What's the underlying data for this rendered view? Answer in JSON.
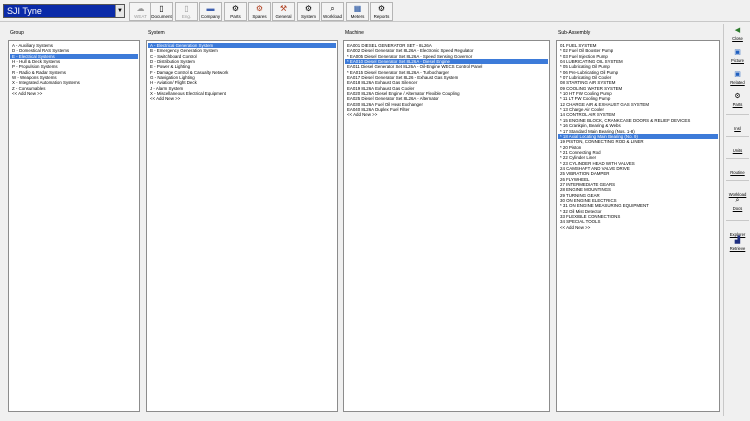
{
  "vessel": {
    "name": "SJI Tyne"
  },
  "toolbar": [
    {
      "label": "WEAT",
      "icon": "weather-icon",
      "disabled": true
    },
    {
      "label": "Document",
      "icon": "document-icon",
      "disabled": false
    },
    {
      "label": "Eng.",
      "icon": "engine-icon",
      "disabled": true
    },
    {
      "label": "Company",
      "icon": "company-icon",
      "disabled": false
    },
    {
      "label": "Parts",
      "icon": "parts-icon",
      "disabled": false
    },
    {
      "label": "Spares",
      "icon": "spares-icon",
      "disabled": false
    },
    {
      "label": "General",
      "icon": "general-icon",
      "disabled": false
    },
    {
      "label": "System",
      "icon": "system-icon",
      "disabled": false
    },
    {
      "label": "Workload",
      "icon": "workload-icon",
      "disabled": false
    },
    {
      "label": "Meters",
      "icon": "meters-icon",
      "disabled": false
    },
    {
      "label": "Reports",
      "icon": "reports-icon",
      "disabled": false
    }
  ],
  "panels": {
    "group": {
      "label": "Group",
      "items": [
        "A - Auxiliary Systems",
        "D - Domestical RAS Systems",
        "E - Electrical Systems",
        "H - Hull & Deck Systems",
        "P - Propulsion Systems",
        "R - Radio & Radar Systems",
        "W - Weapons Systems",
        "X - Integrated Automation Systems",
        "Z - Consumables",
        "<< Add New >>"
      ],
      "selected": 2
    },
    "system": {
      "label": "System",
      "items": [
        "A - Electrical Generation System",
        "B - Emergency Generation System",
        "C - Switchboard Control",
        "D - Distribution System",
        "E - Power & Lighting",
        "F - Damage Control & Casualty Network",
        "G - Navigation Lighting",
        "H - Aviation/ Flight Deck",
        "J - Alarm System",
        "X - Miscellaneous Electrical Equipment",
        "<< Add New >>"
      ],
      "selected": 0
    },
    "machine": {
      "label": "Machine",
      "items": [
        "EA001 DIESEL GENERATOR SET - 8L26A",
        "EA002 Diesel Generator Set 8L26A - Electronic Speed Regulator",
        "* EA005 Diesel Generator Set 8L26A - Speed Sensing Governor",
        "* EA010 Diesel Generator Set 8L26A - Diesel Engine",
        "EA011 Diesel Generator Set 8L26A - Oil-Engine WECS Control Panel",
        "* EA015 Diesel Generator Set 8L26A - Turbocharger",
        "EA017 Diesel Generator Set 8L26 - Exhaust Gas System",
        "EA018 8L26A Exhaust Gas Silencer",
        "EA019 8L26A Exhaust Gas Cooler",
        "EA020 8L26A Diesel Engine / Alternator Flexible Coupling",
        "EA025 Diesel Generator Set 8L26A - Alternator",
        "EA030 8L26A Fuel Oil Heat Exchanger",
        "EA040 8L26A Duplex Fuel Filter",
        "<< Add New >>"
      ],
      "selected": 3
    },
    "subassembly": {
      "label": "Sub-Assembly",
      "items": [
        "01 FUEL SYSTEM",
        "* 02 Fuel Oil Booster Pump",
        "* 03 Fuel Injection Pump",
        "04 LUBRICATING OIL SYSTEM",
        "* 05 Lubricating Oil Pump",
        "* 06 Pre-Lubricating Oil Pump",
        "* 07 Lubricating Oil Cooler",
        "08 STARTING AIR SYSTEM",
        "09 COOLING WATER SYSTEM",
        "* 10 HT FW Cooling Pump",
        "* 11 LT FW Cooling Pump",
        "12 CHARGE AIR & EXHAUST GAS SYSTEM",
        "* 13 Charge Air Cooler",
        "14 CONTROL AIR SYSTEM",
        "* 15 ENGINE BLOCK, CRANKCASE DOORS & RELIEF DEVICES",
        "* 16 Crankpin, Bearing & Webs",
        "* 17 Standard Main Bearing (Nos. 1-8)",
        "* 18 Axial Locating Main Bearing (No. 9)",
        "19 PISTON, CONNECTING ROD & LINER",
        "* 20 Piston",
        "* 21 Connecting Rod",
        "* 22 Cylinder Liner",
        "* 23 CYLINDER HEAD WITH VALVES",
        "24 CAMSHAFT AND VALVE DRIVE",
        "25 VIBRATION DAMPER",
        "26 FLYWHEEL",
        "27 INTERMEDIATE GEARS",
        "28 ENGINE MOUNTINGS",
        "29 TURNING GEAR",
        "30 ON ENGINE ELECTRICS",
        "* 31 ON ENGINE MEASURING EQUIPMENT",
        "* 32 Oil Mist Detector",
        "33 FLEXIBLE CONNECTIONS",
        "34 SPECIAL TOOLS",
        "<< Add New >>"
      ],
      "selected": 17
    }
  },
  "rightbar": [
    {
      "label": "Close",
      "icon": "close-icon"
    },
    {
      "label": "Picture",
      "icon": "picture-icon"
    },
    {
      "label": "Related",
      "icon": "related-icon"
    },
    {
      "label": "Parts",
      "icon": "parts-icon"
    },
    {
      "label": "Insl",
      "icon": ""
    },
    {
      "label": "Units",
      "icon": ""
    },
    {
      "label": "Routine",
      "icon": ""
    },
    {
      "label": "Workload",
      "icon": ""
    },
    {
      "label": "Docs",
      "icon": "docs-icon"
    },
    {
      "label": "Explorer",
      "icon": ""
    },
    {
      "label": "Retrieve",
      "icon": "retrieve-icon"
    }
  ],
  "colors": {
    "selection": "#3d7bd9",
    "vessel_bg": "#0a2aa8"
  }
}
